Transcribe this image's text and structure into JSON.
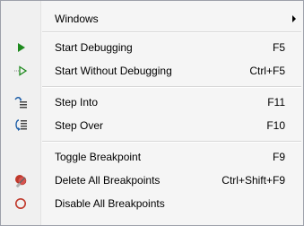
{
  "menu": {
    "windows": {
      "label": "Windows",
      "icon": ""
    },
    "start_debugging": {
      "label": "Start Debugging",
      "shortcut": "F5",
      "icon": "play-icon"
    },
    "start_without_debugging": {
      "label": "Start Without Debugging",
      "shortcut": "Ctrl+F5",
      "icon": "play-without-debugging-icon"
    },
    "step_into": {
      "label": "Step Into",
      "shortcut": "F11",
      "icon": "step-into-icon"
    },
    "step_over": {
      "label": "Step Over",
      "shortcut": "F10",
      "icon": "step-over-icon"
    },
    "toggle_breakpoint": {
      "label": "Toggle Breakpoint",
      "shortcut": "F9",
      "icon": ""
    },
    "delete_all_breakpoints": {
      "label": "Delete All Breakpoints",
      "shortcut": "Ctrl+Shift+F9",
      "icon": "delete-breakpoints-icon"
    },
    "disable_all_breakpoints": {
      "label": "Disable All Breakpoints",
      "icon": "disable-breakpoints-icon"
    }
  },
  "colors": {
    "play_green": "#1e8a1e",
    "breakpoint_red": "#c0392b"
  }
}
